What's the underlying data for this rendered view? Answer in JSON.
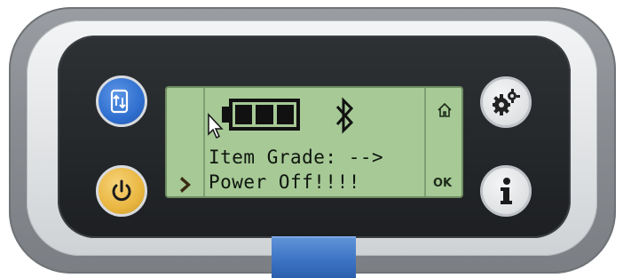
{
  "device": {
    "buttons": {
      "sync_icon": "device-sync-icon",
      "power_icon": "power-icon",
      "settings_icon": "gear-icon",
      "info_icon": "info-icon"
    },
    "colors": {
      "sync_button": "#2f6fcf",
      "power_button": "#e9b640",
      "lcd_background": "#a6c996",
      "bezel": "#25282b",
      "tab": "#3c74c4"
    }
  },
  "screen": {
    "battery_icon": "battery-full-icon",
    "bluetooth_icon": "bluetooth-icon",
    "line1": "Item Grade: -->",
    "line2": "Power Off!!!!",
    "nav_left_icon": "chevron-right-icon",
    "nav_top_icon": "home-icon",
    "ok_label": "OK"
  }
}
